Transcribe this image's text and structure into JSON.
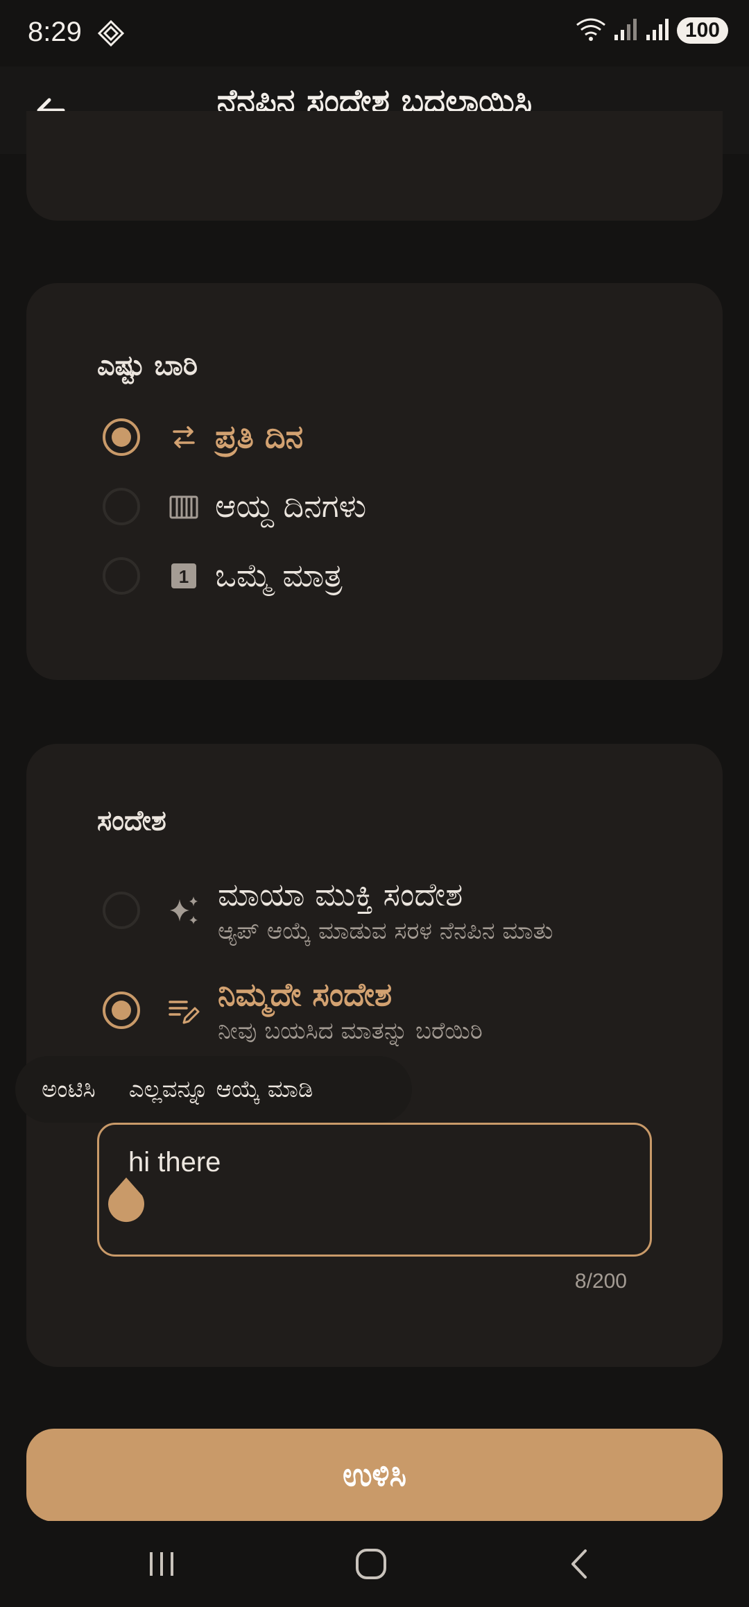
{
  "status_bar": {
    "time": "8:29",
    "battery": "100"
  },
  "app_bar": {
    "title": "ನೆನಪಿನ ಸಂದೇಶ ಬದಲಾಯಿಸಿ",
    "back_icon": "arrow-left-icon"
  },
  "frequency": {
    "title": "ಎಷ್ಟು ಬಾರಿ",
    "options": [
      {
        "label": "ಪ್ರತಿ ದಿನ",
        "icon": "repeat-icon",
        "selected": true
      },
      {
        "label": "ಆಯ್ದ ದಿನಗಳು",
        "icon": "calendar-week-icon",
        "selected": false
      },
      {
        "label": "ಒಮ್ಮೆ ಮಾತ್ರ",
        "icon": "one-day-icon",
        "icon_text": "1",
        "selected": false
      }
    ]
  },
  "message": {
    "title": "ಸಂದೇಶ",
    "options": [
      {
        "label": "ಮಾಯಾ ಮುಕ್ತಿ ಸಂದೇಶ",
        "sub": "ಆ್ಯಪ್ ಆಯ್ಕೆ ಮಾಡುವ ಸರಳ ನೆನಪಿನ ಮಾತು",
        "icon": "sparkles-icon",
        "selected": false
      },
      {
        "label": "ನಿಮ್ಮದೇ ಸಂದೇಶ",
        "sub": "ನೀವು ಬಯಸಿದ ಮಾತನ್ನು ಬರೆಯಿರಿ",
        "icon": "edit-note-icon",
        "selected": true
      }
    ],
    "context_menu": {
      "paste": "ಅಂಟಿಸಿ",
      "select_all": "ಎಲ್ಲವನ್ನೂ ಆಯ್ಕೆ ಮಾಡಿ"
    },
    "input_value": "hi there",
    "counter": "8/200"
  },
  "save_button": {
    "label": "ಉಳಿಸಿ"
  },
  "colors": {
    "accent": "#c99a69",
    "background": "#141312",
    "card": "#201d1b"
  }
}
